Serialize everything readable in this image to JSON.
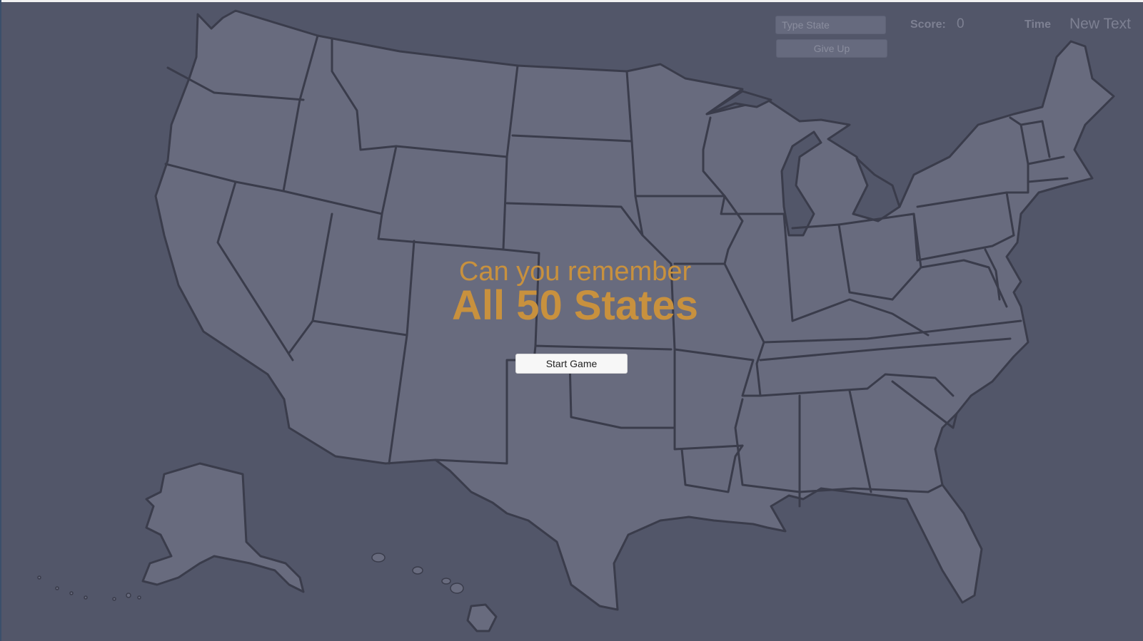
{
  "hud": {
    "state_input_placeholder": "Type State",
    "give_up_label": "Give Up",
    "score_label": "Score:",
    "score_value": "0",
    "time_label": "Time",
    "time_value": "New Text"
  },
  "intro": {
    "subtitle": "Can you remember",
    "title": "All 50 States",
    "start_button_label": "Start Game"
  },
  "colors": {
    "background": "#525669",
    "land": "#686b7e",
    "borders": "#3a3c4b",
    "title": "#c8913e"
  }
}
